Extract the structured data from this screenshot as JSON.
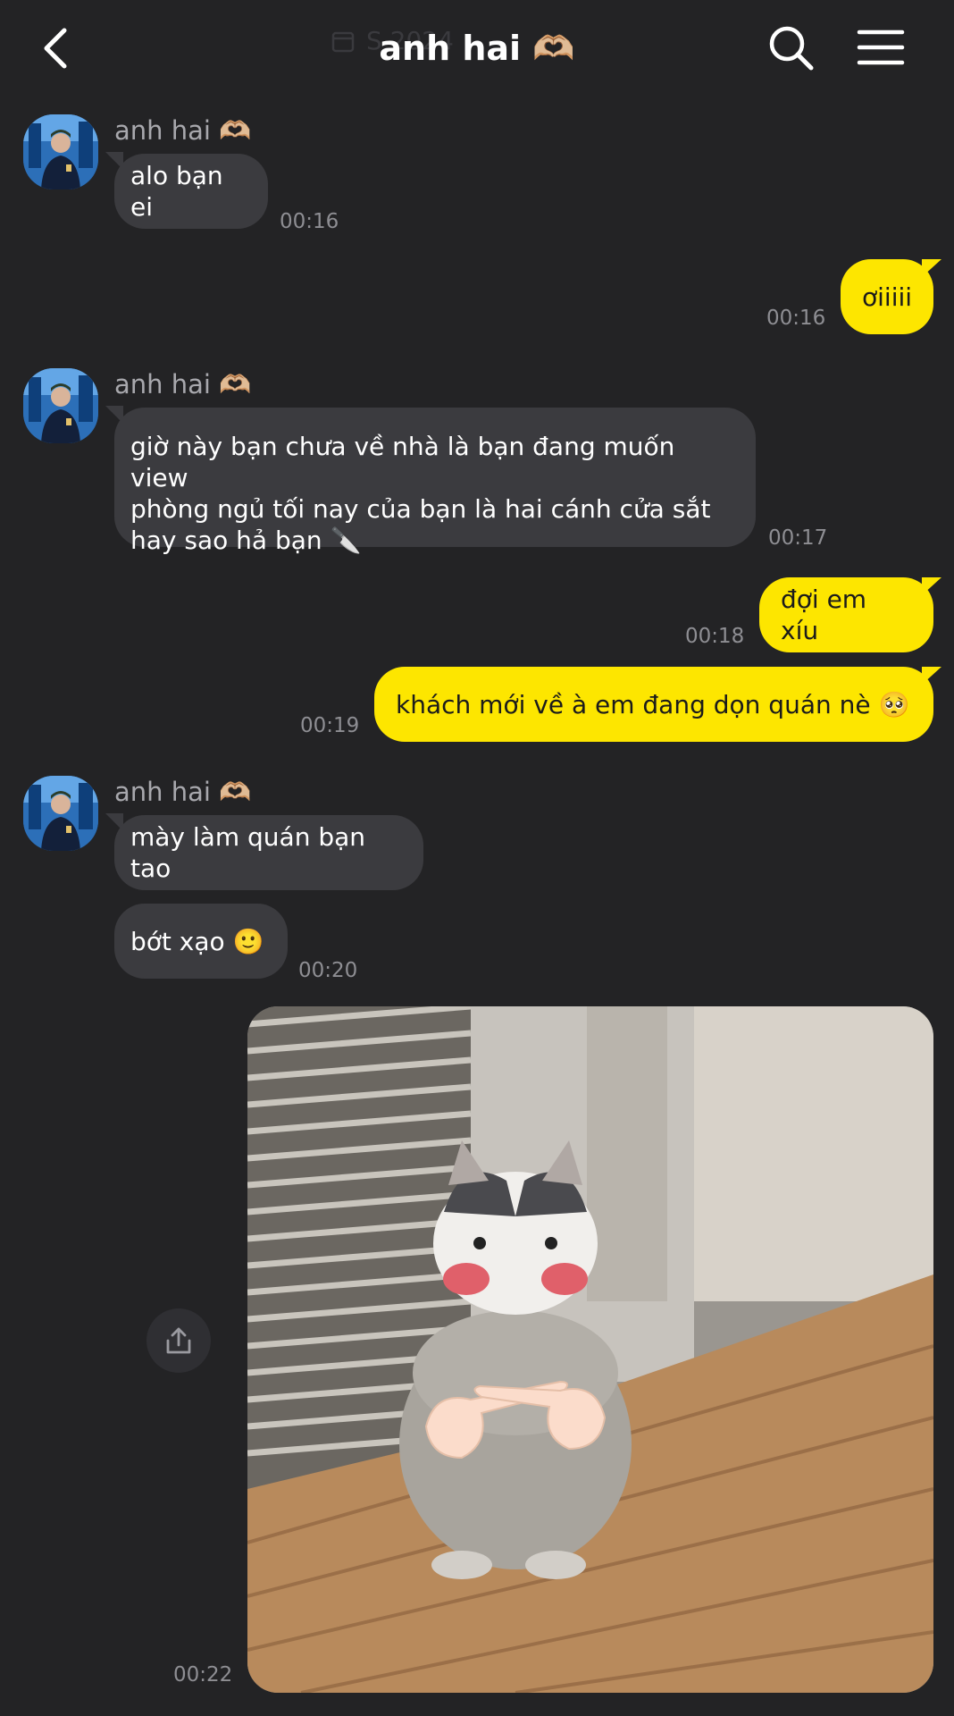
{
  "header": {
    "date_label": "S         2024",
    "title": "anh hai 🫶🏼",
    "back_icon": "chevron-left-icon",
    "search_icon": "search-icon",
    "menu_icon": "hamburger-menu-icon"
  },
  "contact": {
    "name": "anh hai 🫶🏼"
  },
  "messages": [
    {
      "from": "them",
      "text": "alo bạn ei",
      "time": "00:16"
    },
    {
      "from": "me",
      "text": "ơiiiii",
      "time": "00:16"
    },
    {
      "from": "them",
      "lines": [
        "giờ này bạn chưa về nhà là bạn đang muốn view",
        "phòng ngủ tối nay của bạn là hai cánh cửa sắt",
        "hay sao hả bạn 🔪"
      ],
      "time": "00:17"
    },
    {
      "from": "me",
      "text": "đợi em xíu",
      "time": "00:18"
    },
    {
      "from": "me",
      "text": "khách mới về à em đang dọn quán nè 🥺",
      "time": "00:19"
    },
    {
      "from": "them",
      "text": "mày làm quán bạn tao"
    },
    {
      "from": "them",
      "text": "bớt xạo 🙂",
      "time": "00:20"
    },
    {
      "from": "me",
      "type": "image",
      "time": "00:22"
    }
  ],
  "colors": {
    "background": "#232325",
    "incoming_bubble": "#3b3b3f",
    "outgoing_bubble": "#fde600",
    "timestamp": "#8e8e93"
  }
}
